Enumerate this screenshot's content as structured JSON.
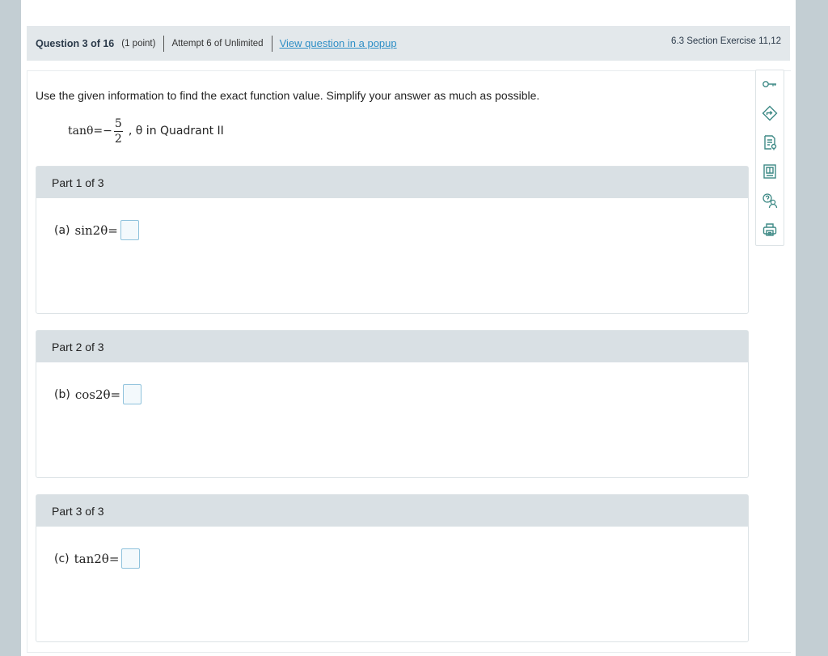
{
  "header": {
    "question": "Question 3 of 16",
    "points": "(1 point)",
    "attempt": "Attempt 6 of Unlimited",
    "popup_link": "View question in a popup",
    "section": "6.3 Section Exercise 11,12"
  },
  "problem": {
    "instructions": "Use the given information to find the exact function value. Simplify your answer as much as possible.",
    "given_lhs": "tanθ=−",
    "given_num": "5",
    "given_den": "2",
    "given_rest": ", θ in Quadrant II"
  },
  "parts": [
    {
      "title": "Part 1 of 3",
      "label": "(a)",
      "expr": "sin2θ="
    },
    {
      "title": "Part 2 of 3",
      "label": "(b)",
      "expr": "cos2θ="
    },
    {
      "title": "Part 3 of 3",
      "label": "(c)",
      "expr": "tan2θ="
    }
  ],
  "toolbar": {
    "icons": [
      "key-icon",
      "directions-icon",
      "worksheet-icon",
      "ebook-icon",
      "ask-help-icon",
      "print-icon"
    ],
    "accent": "#3e8a86"
  },
  "colors": {
    "header_bg": "#e3e8eb",
    "link": "#2f8fc6",
    "part_header_bg": "#d9e0e4",
    "answer_border": "#8fc2dc"
  }
}
